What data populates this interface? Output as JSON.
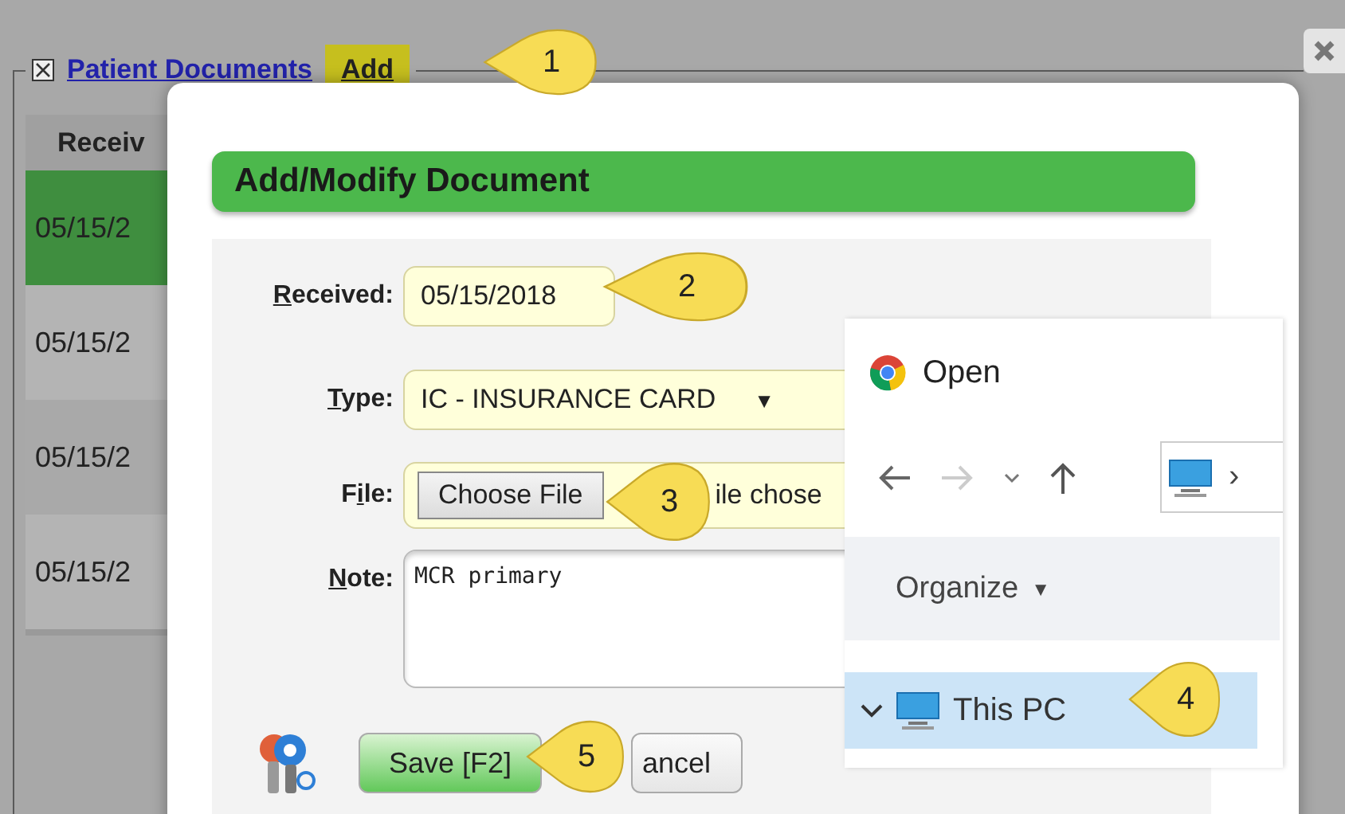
{
  "panel": {
    "checkbox": {
      "checked": true
    },
    "title_link": "Patient Documents",
    "add_link": {
      "label": "Add",
      "selected": true
    }
  },
  "table": {
    "columns": [
      "Receiv"
    ],
    "rows": [
      {
        "cells": [
          "05/15/2"
        ],
        "selected": true
      },
      {
        "cells": [
          "05/15/2"
        ],
        "selected": false
      },
      {
        "cells": [
          "05/15/2"
        ],
        "selected": false
      },
      {
        "cells": [
          "05/15/2"
        ],
        "selected": false
      }
    ]
  },
  "dialog": {
    "title": "Add/Modify Document",
    "fields": [
      {
        "kind": "date",
        "access_key": "R",
        "label_after": "eceived:",
        "value": "05/15/2018"
      },
      {
        "kind": "select",
        "access_key": "T",
        "label_after": "ype:",
        "value": "IC - INSURANCE CARD",
        "arrow": "▼"
      },
      {
        "kind": "file",
        "label_before": "F",
        "access_key": "i",
        "label_after": "le:",
        "button": "Choose File",
        "status": "ile chose"
      },
      {
        "kind": "note",
        "access_key": "N",
        "label_after": "ote:",
        "value": "MCR primary"
      }
    ],
    "buttons": [
      {
        "kind": "save",
        "label": "Save [F2]"
      },
      {
        "kind": "cancel",
        "label": "ancel"
      }
    ]
  },
  "open_dialog": {
    "title": "Open",
    "breadcrumb_arrow": "›",
    "organize": "Organize",
    "organize_arrow": "▼",
    "tree": [
      {
        "label": "This PC",
        "expanded": true,
        "selected": true
      }
    ]
  },
  "callouts": [
    "1",
    "2",
    "3",
    "4",
    "5"
  ]
}
